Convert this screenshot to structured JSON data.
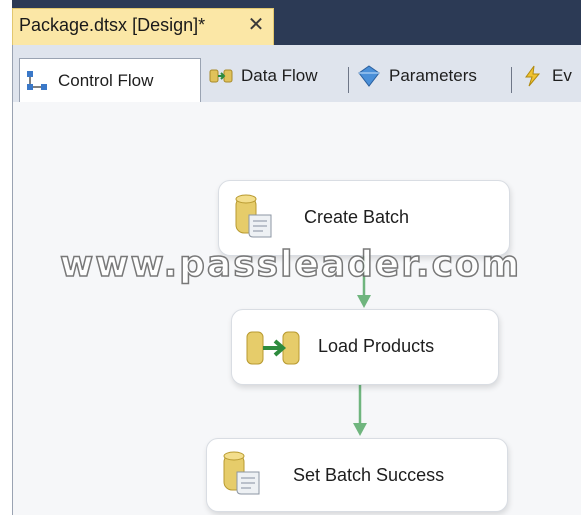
{
  "document_tab": {
    "title": "Package.dtsx [Design]*",
    "close_glyph": "✕"
  },
  "designer_tabs": [
    {
      "label": "Control Flow",
      "icon": "control-flow-icon",
      "active": true
    },
    {
      "label": "Data Flow",
      "icon": "data-flow-icon",
      "active": false
    },
    {
      "label": "Parameters",
      "icon": "parameters-icon",
      "active": false
    },
    {
      "label": "Ev",
      "icon": "event-handlers-icon",
      "active": false
    }
  ],
  "tasks": [
    {
      "label": "Create Batch",
      "icon": "execute-sql-task-icon"
    },
    {
      "label": "Load Products",
      "icon": "data-flow-task-icon"
    },
    {
      "label": "Set Batch Success",
      "icon": "execute-sql-task-icon"
    }
  ],
  "watermark": "www.passleader.com",
  "colors": {
    "doc_strip": "#2c3a55",
    "active_doc_tab": "#fbe7a6",
    "precedence_arrow": "#6fb57e",
    "canvas": "#f6f7f9"
  }
}
